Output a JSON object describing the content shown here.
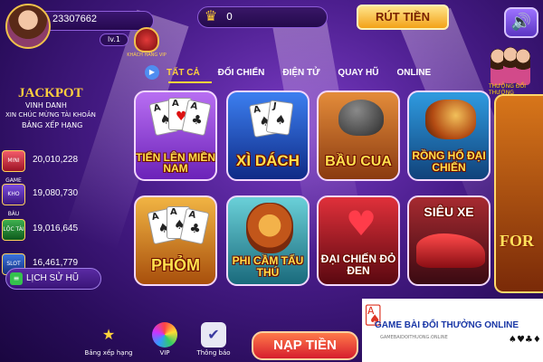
{
  "profile": {
    "user_id": "23307662",
    "level": "lv.1",
    "rank_badge": "KHÁCH HÀNG VIP"
  },
  "wallet": {
    "coins": "0"
  },
  "header": {
    "withdraw_label": "RÚT TIỀN"
  },
  "tabs": [
    {
      "label": "TẤT CẢ",
      "active": true
    },
    {
      "label": "ĐỐI CHIẾN",
      "active": false
    },
    {
      "label": "ĐIỆN TỬ",
      "active": false
    },
    {
      "label": "QUAY HŨ",
      "active": false
    },
    {
      "label": "ONLINE",
      "active": false
    }
  ],
  "jackpot": {
    "title": "JACKPOT",
    "honor": "VINH DANH",
    "congrats": "XIN CHÚC MỪNG TÀI KHOẢN",
    "ranking": "BẢNG XẾP HẠNG",
    "rows": [
      {
        "icon_label": "MINI GAME",
        "value": "20,010,228"
      },
      {
        "icon_label": "KHO BÁU",
        "value": "19,080,730"
      },
      {
        "icon_label": "LỘC TÀI",
        "value": "19,016,645"
      },
      {
        "icon_label": "SLOT",
        "value": "16,461,779"
      }
    ],
    "history_label": "LỊCH SỬ HŨ"
  },
  "games": [
    {
      "title": "TIẾN LÊN MIỀN NAM"
    },
    {
      "title": "XÌ DÁCH"
    },
    {
      "title": "BẦU CUA"
    },
    {
      "title": "RỒNG HỔ ĐẠI CHIẾN"
    },
    {
      "title": "PHỎM"
    },
    {
      "title": "PHI CẦM TẨU THÚ"
    },
    {
      "title": "ĐẠI CHIẾN ĐỎ ĐEN"
    },
    {
      "title": "SIÊU XE"
    }
  ],
  "side_banner": {
    "label": "THƯỞNG ĐỔI THƯỞNG",
    "fortune_text": "FOR"
  },
  "bottom_nav": [
    {
      "label": "Bảng xếp hạng",
      "icon": "trophy-star-icon"
    },
    {
      "label": "VIP",
      "icon": "vip-wheel-icon"
    },
    {
      "label": "Thông báo",
      "icon": "notification-icon"
    }
  ],
  "deposit_label": "NẠP TIỀN",
  "watermark": {
    "title": "GAME BÀI ĐỔI THƯỞNG ONLINE",
    "sub": "GAMEBAIDOITHUONG.ONLINE",
    "suits": "♠♥♣♦"
  },
  "colors": {
    "accent_gold": "#ffd23c",
    "background": "#4a1d8c",
    "deposit": "#d61d2d"
  }
}
